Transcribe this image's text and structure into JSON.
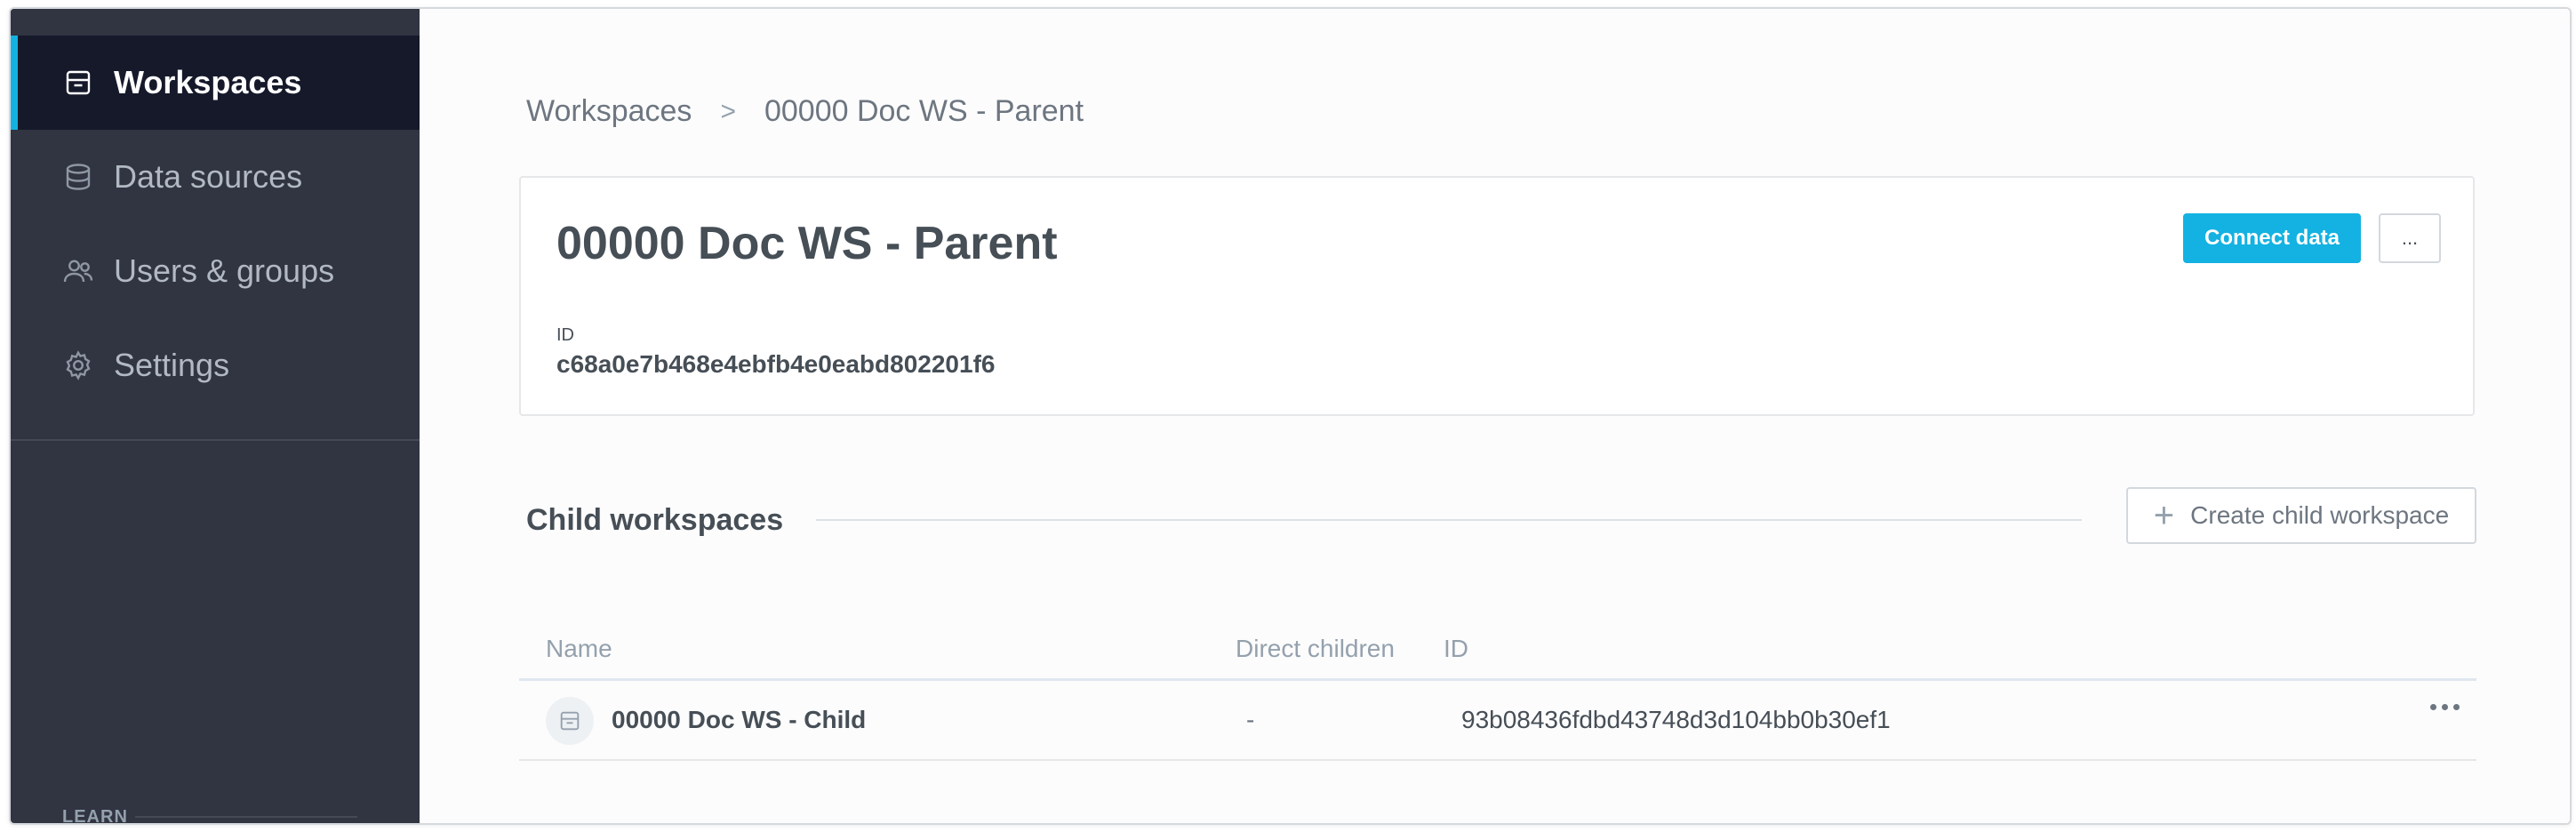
{
  "sidebar": {
    "items": [
      {
        "label": "Workspaces",
        "icon": "workspace-icon",
        "active": true
      },
      {
        "label": "Data sources",
        "icon": "database-icon",
        "active": false
      },
      {
        "label": "Users & groups",
        "icon": "users-icon",
        "active": false
      },
      {
        "label": "Settings",
        "icon": "gear-icon",
        "active": false
      }
    ],
    "learn_label": "LEARN"
  },
  "breadcrumb": {
    "root": "Workspaces",
    "separator": ">",
    "current": "00000 Doc WS - Parent"
  },
  "workspace": {
    "title": "00000 Doc WS - Parent",
    "connect_label": "Connect data",
    "more_label": "...",
    "id_label": "ID",
    "id_value": "c68a0e7b468e4ebfb4e0eabd802201f6"
  },
  "child_section": {
    "title": "Child workspaces",
    "create_label": "Create child workspace",
    "columns": [
      "Name",
      "Direct children",
      "ID"
    ],
    "rows": [
      {
        "name": "00000 Doc WS - Child",
        "direct_children": "-",
        "id": "93b08436fdbd43748d3d104bb0b30ef1"
      }
    ]
  },
  "colors": {
    "sidebar_bg": "#313441",
    "sidebar_active_bg": "#15192a",
    "accent": "#14b2e2"
  }
}
